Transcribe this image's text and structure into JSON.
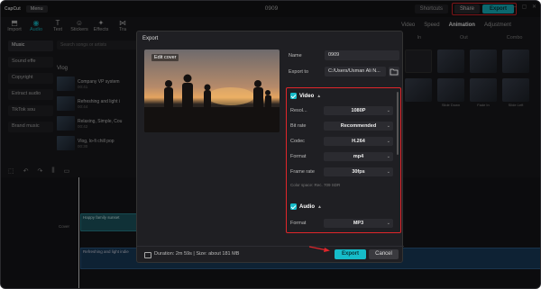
{
  "app": {
    "logo": "CapCut",
    "menu_label": "Menu",
    "project_title": "0909",
    "shortcuts_label": "Shortcuts",
    "share_label": "Share",
    "export_label": "Export"
  },
  "toolbar": {
    "items": [
      {
        "label": "Import"
      },
      {
        "label": "Audio"
      },
      {
        "label": "Text"
      },
      {
        "label": "Stickers"
      },
      {
        "label": "Effects"
      },
      {
        "label": "Tra"
      }
    ]
  },
  "leftnav": {
    "items": [
      {
        "label": "Music"
      },
      {
        "label": "Sound effe"
      },
      {
        "label": "Copyright"
      },
      {
        "label": "Extract audio"
      },
      {
        "label": "TikTok sou"
      },
      {
        "label": "Brand music"
      }
    ]
  },
  "media": {
    "search_placeholder": "Search songs or artists",
    "category": "Vlog",
    "items": [
      {
        "title": "Company VP system",
        "sub": "00:41"
      },
      {
        "title": "Refreshing and light i",
        "sub": "00:44"
      },
      {
        "title": "Relaxing, Simple, Cou",
        "sub": "00:42"
      },
      {
        "title": "Vlog, lo-fi chill pop",
        "sub": "00:30"
      }
    ]
  },
  "rightpanel": {
    "tabs": [
      "Video",
      "Speed",
      "Animation",
      "Adjustment"
    ],
    "active_tab": "Animation",
    "subtabs": [
      "In",
      "Out",
      "Combo"
    ],
    "cells": [
      "",
      "",
      "",
      "",
      "",
      "Slide Down",
      "Fade In",
      "Slide Left",
      "",
      "",
      "",
      ""
    ]
  },
  "timeline": {
    "clip1_label": "Happy family sunset",
    "clip2_label": "Refreshing and light indie",
    "cover_label": "Cover"
  },
  "dialog": {
    "title": "Export",
    "edit_cover": "Edit cover",
    "name_label": "Name",
    "name_value": "0909",
    "export_to_label": "Export to",
    "export_to_value": "C:/Users/Usman Ali N...",
    "video_section": "Video",
    "audio_section": "Audio",
    "video_rows": [
      {
        "label": "Resol...",
        "value": "1080P"
      },
      {
        "label": "Bit rate",
        "value": "Recommended"
      },
      {
        "label": "Codec",
        "value": "H.264"
      },
      {
        "label": "Format",
        "value": "mp4"
      },
      {
        "label": "Frame rate",
        "value": "30fps"
      }
    ],
    "color_space": "Color space: Rec. 709 SDR",
    "audio_rows": [
      {
        "label": "Format",
        "value": "MP3"
      }
    ],
    "footer_info": "Duration: 2m 59s | Size: about 181 MB",
    "export_button": "Export",
    "cancel_button": "Cancel"
  },
  "colors": {
    "accent": "#16bcc9",
    "highlight": "#e0262b"
  }
}
